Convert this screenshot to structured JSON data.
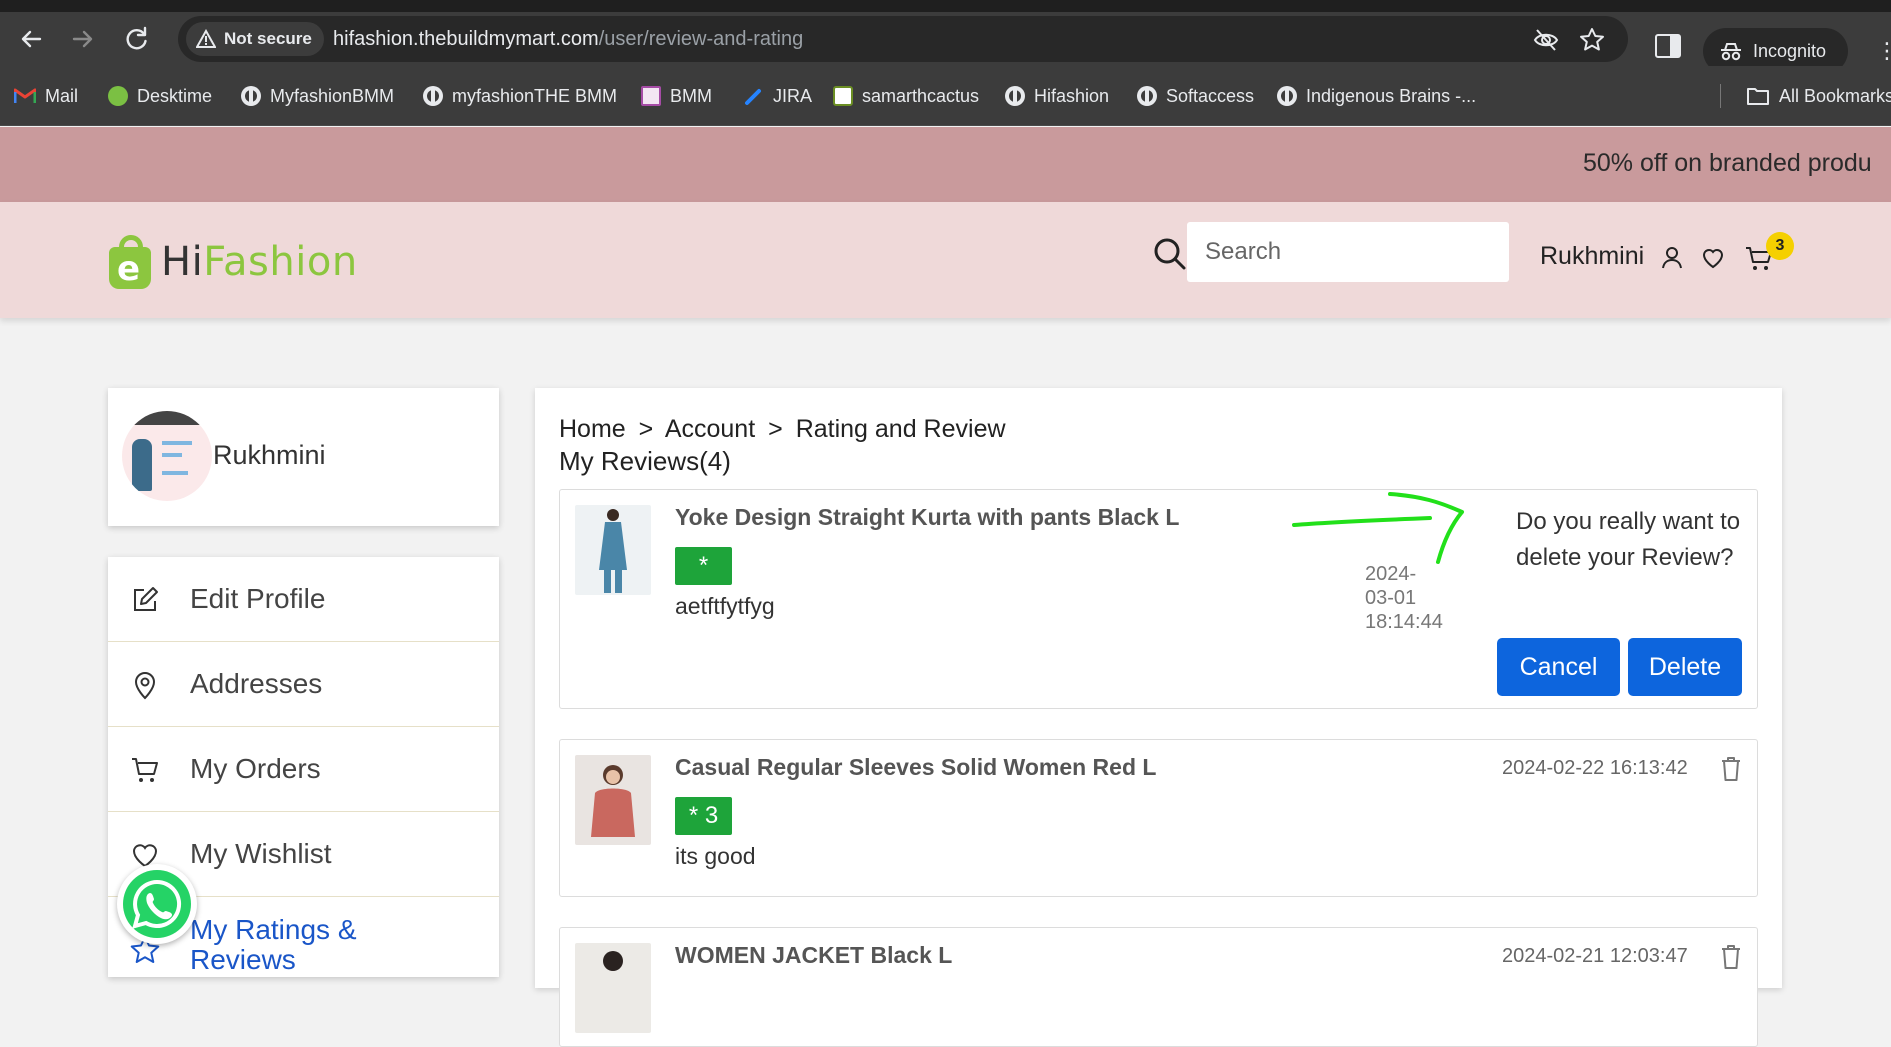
{
  "browser": {
    "security_label": "Not secure",
    "url_host": "hifashion.thebuildmymart.com",
    "url_path": "/user/review-and-rating",
    "incognito_label": "Incognito",
    "bookmarks": [
      {
        "label": "Mail",
        "icon": "gmail-icon"
      },
      {
        "label": "Desktime",
        "icon": "desktime-icon"
      },
      {
        "label": "MyfashionBMM",
        "icon": "globe-icon"
      },
      {
        "label": "myfashionTHE BMM",
        "icon": "globe-icon"
      },
      {
        "label": "BMM",
        "icon": "bmm-icon"
      },
      {
        "label": "JIRA",
        "icon": "jira-icon"
      },
      {
        "label": "samarthcactus",
        "icon": "cactus-icon"
      },
      {
        "label": "Hifashion",
        "icon": "globe-icon"
      },
      {
        "label": "Softaccess",
        "icon": "globe-icon"
      },
      {
        "label": "Indigenous Brains -...",
        "icon": "globe-icon"
      }
    ],
    "all_bookmarks_label": "All Bookmarks"
  },
  "announcement": "50% off on branded produ",
  "header": {
    "logo_letter": "e",
    "logo_hi": "Hi",
    "logo_fashion": "Fashion",
    "search_placeholder": "Search",
    "user_name": "Rukhmini",
    "cart_count": "3"
  },
  "sidebar": {
    "profile_name": "Rukhmini",
    "items": [
      {
        "label": "Edit Profile",
        "icon": "edit-icon"
      },
      {
        "label": "Addresses",
        "icon": "location-pin-icon"
      },
      {
        "label": "My Orders",
        "icon": "cart-icon"
      },
      {
        "label": "My Wishlist",
        "icon": "heart-icon"
      },
      {
        "label": "My Ratings &\nReviews",
        "icon": "star-icon",
        "active": true
      }
    ]
  },
  "main": {
    "breadcrumb": [
      "Home",
      ">",
      "Account",
      ">",
      "Rating and Review"
    ],
    "title": "My Reviews(4)",
    "reviews": [
      {
        "product": "Yoke Design Straight Kurta with pants Black L",
        "rating": "*",
        "text": "aetftfytfyg",
        "date_parts": [
          "2024-",
          "03-01",
          "18:14:44"
        ],
        "confirm_text": "Do you really want to delete your Review?",
        "cancel_label": "Cancel",
        "delete_label": "Delete"
      },
      {
        "product": "Casual Regular Sleeves Solid Women Red L",
        "rating": "* 3",
        "text": "its good",
        "date": "2024-02-22 16:13:42"
      },
      {
        "product": "WOMEN JACKET Black L",
        "date": "2024-02-21 12:03:47"
      }
    ]
  },
  "colors": {
    "brand_green": "#8cc63f",
    "rating_green": "#1ea43a",
    "button_blue": "#0d65dd",
    "announcement_bg": "#c99a9c",
    "header_bg": "#efd9d9"
  }
}
